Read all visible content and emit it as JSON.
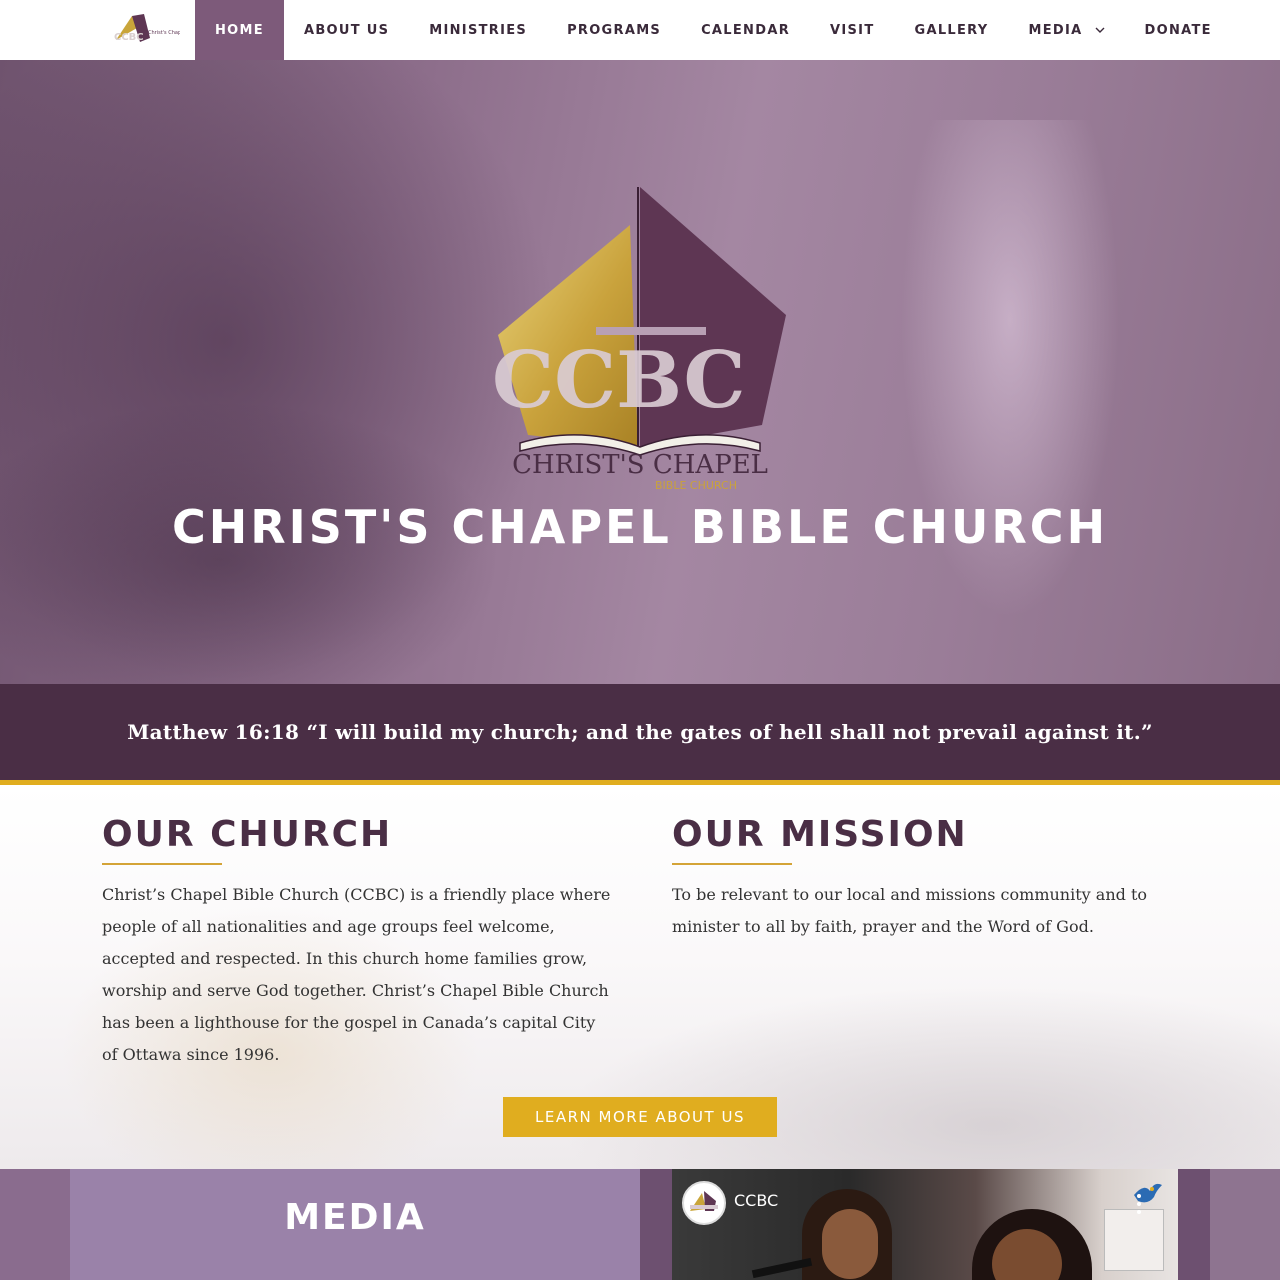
{
  "nav": {
    "items": [
      {
        "label": "HOME"
      },
      {
        "label": "ABOUT US"
      },
      {
        "label": "MINISTRIES"
      },
      {
        "label": "PROGRAMS"
      },
      {
        "label": "CALENDAR"
      },
      {
        "label": "VISIT"
      },
      {
        "label": "GALLERY"
      },
      {
        "label": "MEDIA"
      },
      {
        "label": "DONATE"
      }
    ],
    "active_index": 0
  },
  "hero": {
    "logo": {
      "letters": "CCBC",
      "line1": "CHRIST'S CHAPEL",
      "line2": "BIBLE CHURCH"
    },
    "title": "CHRIST'S CHAPEL BIBLE CHURCH"
  },
  "verse": {
    "text": "Matthew 16:18  “I will build my church; and the gates of hell shall not prevail against it.”"
  },
  "about": {
    "church_heading": "OUR CHURCH",
    "church_text": "Christ’s Chapel Bible Church (CCBC) is a friendly place where people of all nationalities and age groups feel welcome, accepted and respected. In this church home families grow, worship and serve God together.  Christ’s Chapel Bible Church has been a lighthouse for the gospel in Canada’s capital City of Ottawa since 1996.",
    "mission_heading": "OUR MISSION",
    "mission_text": "To be relevant to our local and missions community and to minister to all by faith, prayer and the Word of God.",
    "button_label": "LEARN MORE ABOUT US"
  },
  "media": {
    "heading": "MEDIA",
    "video_channel": "CCBC"
  },
  "colors": {
    "brand_purple": "#4a2e45",
    "active_nav": "#7d5a7a",
    "gold": "#e0ad1f"
  },
  "icons": [
    "chevron-down-icon",
    "kebab-menu-icon",
    "dove-icon"
  ]
}
